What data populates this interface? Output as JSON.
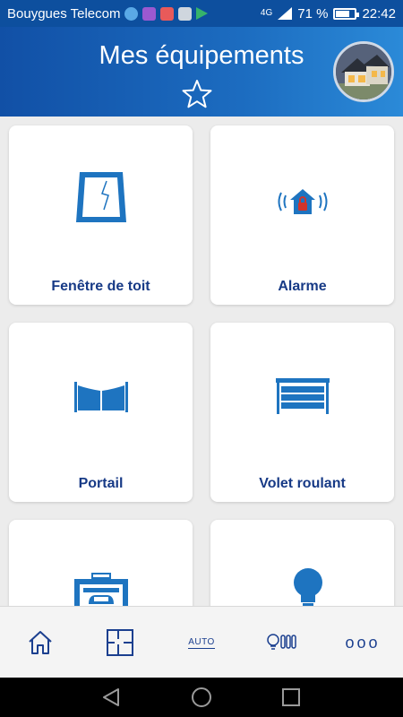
{
  "status_bar": {
    "carrier": "Bouygues Telecom",
    "network": "4G",
    "battery": "71 %",
    "time": "22:42"
  },
  "header": {
    "title": "Mes équipements"
  },
  "equipment": [
    {
      "label": "Fenêtre de toit",
      "icon": "roof-window-icon"
    },
    {
      "label": "Alarme",
      "icon": "alarm-icon"
    },
    {
      "label": "Portail",
      "icon": "gate-icon"
    },
    {
      "label": "Volet roulant",
      "icon": "roller-shutter-icon"
    },
    {
      "label": "",
      "icon": "garage-door-icon"
    },
    {
      "label": "",
      "icon": "light-bulb-icon"
    }
  ],
  "bottom_nav": {
    "items": [
      {
        "name": "home-icon"
      },
      {
        "name": "floor-plan-icon"
      },
      {
        "name": "auto-icon",
        "label": "AUTO"
      },
      {
        "name": "devices-icon"
      },
      {
        "name": "more-icon",
        "label": "ooo"
      }
    ]
  },
  "colors": {
    "brand_blue": "#1150a6",
    "icon_blue": "#1e74c0",
    "label_blue": "#173a86",
    "alarm_red": "#d0342c"
  }
}
